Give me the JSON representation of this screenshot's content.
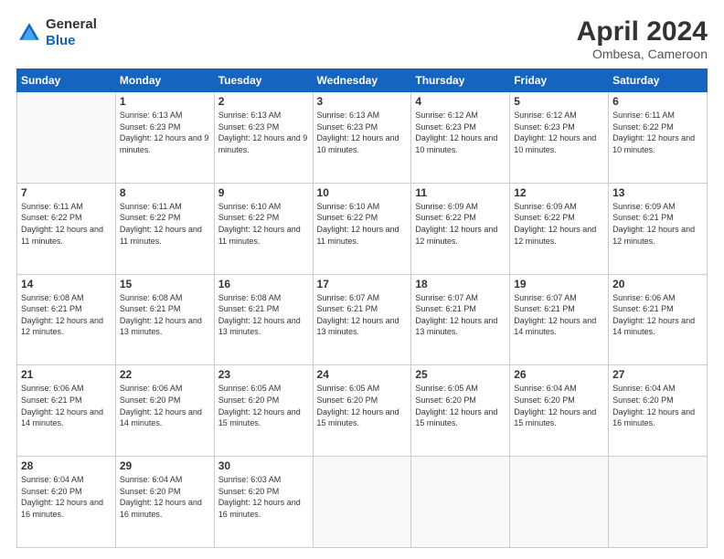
{
  "header": {
    "logo_line1": "General",
    "logo_line2": "Blue",
    "month_title": "April 2024",
    "location": "Ombesa, Cameroon"
  },
  "days_of_week": [
    "Sunday",
    "Monday",
    "Tuesday",
    "Wednesday",
    "Thursday",
    "Friday",
    "Saturday"
  ],
  "weeks": [
    [
      {
        "day": "",
        "sunrise": "",
        "sunset": "",
        "daylight": ""
      },
      {
        "day": "1",
        "sunrise": "Sunrise: 6:13 AM",
        "sunset": "Sunset: 6:23 PM",
        "daylight": "Daylight: 12 hours and 9 minutes."
      },
      {
        "day": "2",
        "sunrise": "Sunrise: 6:13 AM",
        "sunset": "Sunset: 6:23 PM",
        "daylight": "Daylight: 12 hours and 9 minutes."
      },
      {
        "day": "3",
        "sunrise": "Sunrise: 6:13 AM",
        "sunset": "Sunset: 6:23 PM",
        "daylight": "Daylight: 12 hours and 10 minutes."
      },
      {
        "day": "4",
        "sunrise": "Sunrise: 6:12 AM",
        "sunset": "Sunset: 6:23 PM",
        "daylight": "Daylight: 12 hours and 10 minutes."
      },
      {
        "day": "5",
        "sunrise": "Sunrise: 6:12 AM",
        "sunset": "Sunset: 6:23 PM",
        "daylight": "Daylight: 12 hours and 10 minutes."
      },
      {
        "day": "6",
        "sunrise": "Sunrise: 6:11 AM",
        "sunset": "Sunset: 6:22 PM",
        "daylight": "Daylight: 12 hours and 10 minutes."
      }
    ],
    [
      {
        "day": "7",
        "sunrise": "Sunrise: 6:11 AM",
        "sunset": "Sunset: 6:22 PM",
        "daylight": "Daylight: 12 hours and 11 minutes."
      },
      {
        "day": "8",
        "sunrise": "Sunrise: 6:11 AM",
        "sunset": "Sunset: 6:22 PM",
        "daylight": "Daylight: 12 hours and 11 minutes."
      },
      {
        "day": "9",
        "sunrise": "Sunrise: 6:10 AM",
        "sunset": "Sunset: 6:22 PM",
        "daylight": "Daylight: 12 hours and 11 minutes."
      },
      {
        "day": "10",
        "sunrise": "Sunrise: 6:10 AM",
        "sunset": "Sunset: 6:22 PM",
        "daylight": "Daylight: 12 hours and 11 minutes."
      },
      {
        "day": "11",
        "sunrise": "Sunrise: 6:09 AM",
        "sunset": "Sunset: 6:22 PM",
        "daylight": "Daylight: 12 hours and 12 minutes."
      },
      {
        "day": "12",
        "sunrise": "Sunrise: 6:09 AM",
        "sunset": "Sunset: 6:22 PM",
        "daylight": "Daylight: 12 hours and 12 minutes."
      },
      {
        "day": "13",
        "sunrise": "Sunrise: 6:09 AM",
        "sunset": "Sunset: 6:21 PM",
        "daylight": "Daylight: 12 hours and 12 minutes."
      }
    ],
    [
      {
        "day": "14",
        "sunrise": "Sunrise: 6:08 AM",
        "sunset": "Sunset: 6:21 PM",
        "daylight": "Daylight: 12 hours and 12 minutes."
      },
      {
        "day": "15",
        "sunrise": "Sunrise: 6:08 AM",
        "sunset": "Sunset: 6:21 PM",
        "daylight": "Daylight: 12 hours and 13 minutes."
      },
      {
        "day": "16",
        "sunrise": "Sunrise: 6:08 AM",
        "sunset": "Sunset: 6:21 PM",
        "daylight": "Daylight: 12 hours and 13 minutes."
      },
      {
        "day": "17",
        "sunrise": "Sunrise: 6:07 AM",
        "sunset": "Sunset: 6:21 PM",
        "daylight": "Daylight: 12 hours and 13 minutes."
      },
      {
        "day": "18",
        "sunrise": "Sunrise: 6:07 AM",
        "sunset": "Sunset: 6:21 PM",
        "daylight": "Daylight: 12 hours and 13 minutes."
      },
      {
        "day": "19",
        "sunrise": "Sunrise: 6:07 AM",
        "sunset": "Sunset: 6:21 PM",
        "daylight": "Daylight: 12 hours and 14 minutes."
      },
      {
        "day": "20",
        "sunrise": "Sunrise: 6:06 AM",
        "sunset": "Sunset: 6:21 PM",
        "daylight": "Daylight: 12 hours and 14 minutes."
      }
    ],
    [
      {
        "day": "21",
        "sunrise": "Sunrise: 6:06 AM",
        "sunset": "Sunset: 6:21 PM",
        "daylight": "Daylight: 12 hours and 14 minutes."
      },
      {
        "day": "22",
        "sunrise": "Sunrise: 6:06 AM",
        "sunset": "Sunset: 6:20 PM",
        "daylight": "Daylight: 12 hours and 14 minutes."
      },
      {
        "day": "23",
        "sunrise": "Sunrise: 6:05 AM",
        "sunset": "Sunset: 6:20 PM",
        "daylight": "Daylight: 12 hours and 15 minutes."
      },
      {
        "day": "24",
        "sunrise": "Sunrise: 6:05 AM",
        "sunset": "Sunset: 6:20 PM",
        "daylight": "Daylight: 12 hours and 15 minutes."
      },
      {
        "day": "25",
        "sunrise": "Sunrise: 6:05 AM",
        "sunset": "Sunset: 6:20 PM",
        "daylight": "Daylight: 12 hours and 15 minutes."
      },
      {
        "day": "26",
        "sunrise": "Sunrise: 6:04 AM",
        "sunset": "Sunset: 6:20 PM",
        "daylight": "Daylight: 12 hours and 15 minutes."
      },
      {
        "day": "27",
        "sunrise": "Sunrise: 6:04 AM",
        "sunset": "Sunset: 6:20 PM",
        "daylight": "Daylight: 12 hours and 16 minutes."
      }
    ],
    [
      {
        "day": "28",
        "sunrise": "Sunrise: 6:04 AM",
        "sunset": "Sunset: 6:20 PM",
        "daylight": "Daylight: 12 hours and 16 minutes."
      },
      {
        "day": "29",
        "sunrise": "Sunrise: 6:04 AM",
        "sunset": "Sunset: 6:20 PM",
        "daylight": "Daylight: 12 hours and 16 minutes."
      },
      {
        "day": "30",
        "sunrise": "Sunrise: 6:03 AM",
        "sunset": "Sunset: 6:20 PM",
        "daylight": "Daylight: 12 hours and 16 minutes."
      },
      {
        "day": "",
        "sunrise": "",
        "sunset": "",
        "daylight": ""
      },
      {
        "day": "",
        "sunrise": "",
        "sunset": "",
        "daylight": ""
      },
      {
        "day": "",
        "sunrise": "",
        "sunset": "",
        "daylight": ""
      },
      {
        "day": "",
        "sunrise": "",
        "sunset": "",
        "daylight": ""
      }
    ]
  ]
}
